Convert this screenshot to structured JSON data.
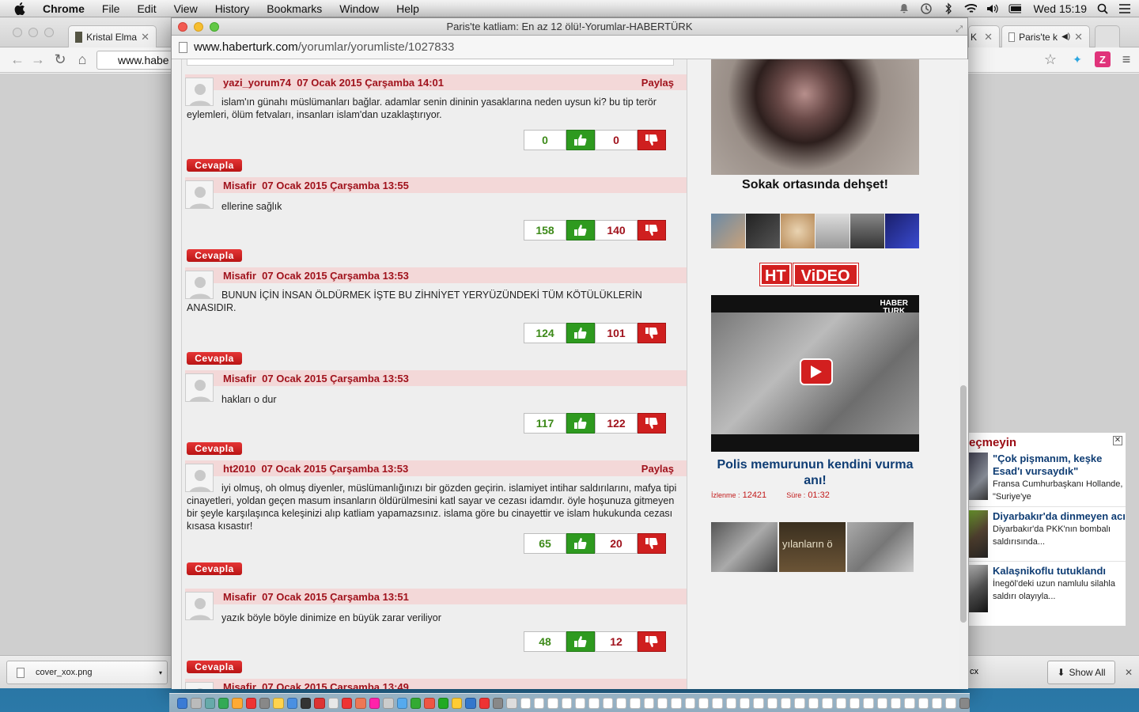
{
  "menubar": {
    "app": "Chrome",
    "items": [
      "File",
      "Edit",
      "View",
      "History",
      "Bookmarks",
      "Window",
      "Help"
    ],
    "clock": "Wed 15:19"
  },
  "chrome": {
    "tabs": [
      {
        "label": "Kristal Elma"
      },
      {
        "label": "K"
      },
      {
        "label": "Paris'te k"
      }
    ],
    "omnibox_text": "www.habe",
    "download": {
      "filename": "cover_xox.png"
    },
    "show_all": "Show All",
    "partial_right": "cx"
  },
  "popup": {
    "title": "Paris'te katliam: En az 12 ölü!-Yorumlar-HABERTÜRK",
    "url_domain": "www.haberturk.com",
    "url_path": "/yorumlar/yorumliste/1027833"
  },
  "comments": [
    {
      "user": "yazi_yorum74",
      "date": "07 Ocak 2015 Çarşamba 14:01",
      "share": "Paylaş",
      "text": "islam'ın günahı müslümanları bağlar. adamlar senin dininin yasaklarına neden uysun ki? bu tip terör eylemleri, ölüm fetvaları, insanları islam'dan uzaklaştırıyor.",
      "up": "0",
      "down": "0",
      "reply": "Cevapla"
    },
    {
      "user": "Misafir",
      "date": "07 Ocak 2015 Çarşamba 13:55",
      "share": "",
      "text": "ellerine sağlık",
      "up": "158",
      "down": "140",
      "reply": "Cevapla"
    },
    {
      "user": "Misafir",
      "date": "07 Ocak 2015 Çarşamba 13:53",
      "share": "",
      "text": "BUNUN İÇİN İNSAN ÖLDÜRMEK İŞTE BU ZİHNİYET YERYÜZÜNDEKİ TÜM KÖTÜLÜKLERİN ANASIDIR.",
      "up": "124",
      "down": "101",
      "reply": "Cevapla"
    },
    {
      "user": "Misafir",
      "date": "07 Ocak 2015 Çarşamba 13:53",
      "share": "",
      "text": "hakları o dur",
      "up": "117",
      "down": "122",
      "reply": "Cevapla"
    },
    {
      "user": "ht2010",
      "date": "07 Ocak 2015 Çarşamba 13:53",
      "share": "Paylaş",
      "text": "iyi olmuş, oh olmuş diyenler, müslümanlığınızı bir gözden geçirin. islamiyet intihar saldırılarını, mafya tipi cinayetleri, yoldan geçen masum insanların öldürülmesini katl sayar ve cezası idamdır. öyle hoşunuza gitmeyen bir şeyle karşılaşınca keleşinizi alıp katliam yapamazsınız. islama göre bu cinayettir ve islam hukukunda cezası kısasa kısastır!",
      "up": "65",
      "down": "20",
      "reply": "Cevapla"
    },
    {
      "user": "Misafir",
      "date": "07 Ocak 2015 Çarşamba 13:51",
      "share": "",
      "text": "yazık böyle böyle dinimize en büyük zarar veriliyor",
      "up": "48",
      "down": "12",
      "reply": "Cevapla"
    },
    {
      "user": "Misafir",
      "date": "07 Ocak 2015 Çarşamba 13:49",
      "share": "",
      "text": "",
      "up": "",
      "down": "",
      "reply": ""
    }
  ],
  "sidebar": {
    "caption": "Sokak ortasında dehşet!",
    "ht_label": "HT",
    "video_label": "ViDEO",
    "video_logo_line1": "HABER",
    "video_logo_line2": "TURK",
    "video_title": "Polis memurunun kendini vurma anı!",
    "views_label": "İzlenme :",
    "views": "12421",
    "duration_label": "Süre :",
    "duration": "01:32",
    "thumb3_text": "yılanların ö"
  },
  "news_widget": {
    "heading": "eçmeyin",
    "items": [
      {
        "title": "\"Çok pişmanım, keşke Esad'ı vursaydık\"",
        "text": "Fransa Cumhurbaşkanı Hollande, \"Suriye'ye"
      },
      {
        "title": "Diyarbakır'da dinmeyen acı",
        "text": "Diyarbakır'da PKK'nın bombalı saldırısında..."
      },
      {
        "title": "Kalaşnikoflu tutuklandı",
        "text": "İnegöl'deki uzun namlulu silahla saldırı olayıyla..."
      }
    ]
  },
  "colors": {
    "accent_red": "#a0121c",
    "comment_header_bg": "#f3d8d8",
    "upvote_green": "#2e9a1f",
    "downvote_red": "#cf1f1f",
    "link_blue": "#0f3d74"
  }
}
